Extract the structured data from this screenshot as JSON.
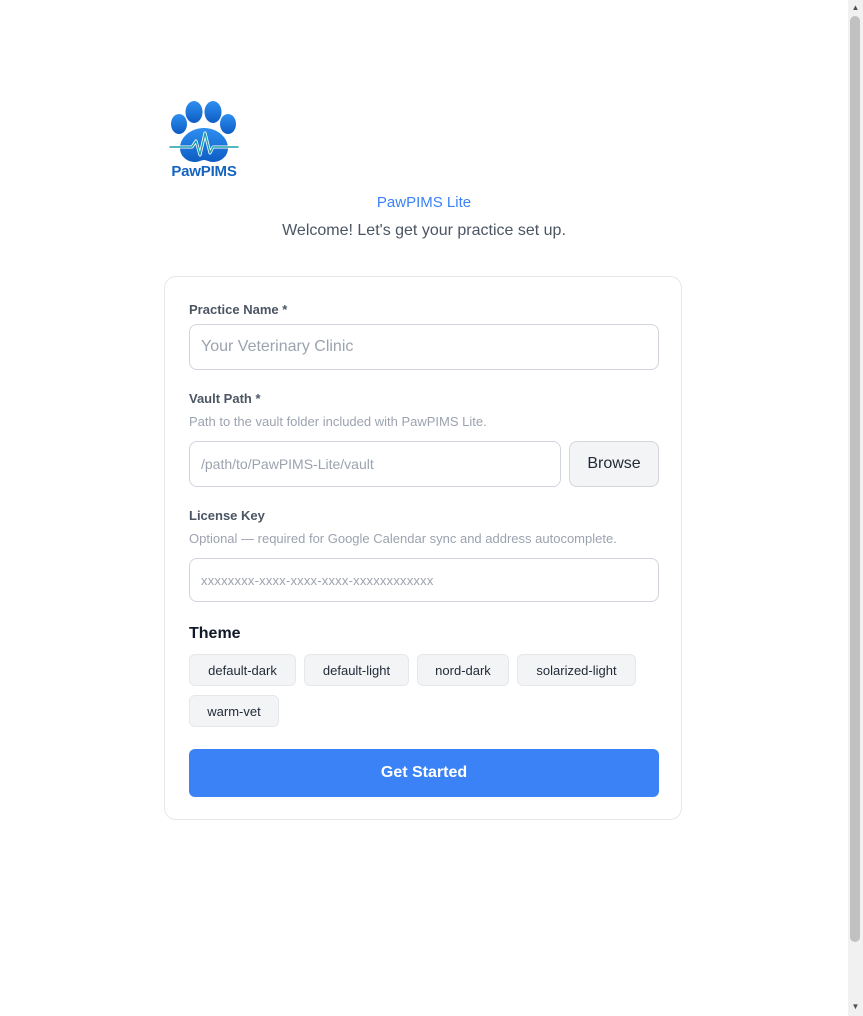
{
  "logo": {
    "text": "PawPIMS",
    "icon": "paw-heartbeat-logo",
    "color": "#1565c0"
  },
  "header": {
    "app_name": "PawPIMS Lite",
    "welcome": "Welcome! Let's get your practice set up."
  },
  "form": {
    "practice_name": {
      "label": "Practice Name *",
      "value": "",
      "placeholder": "Your Veterinary Clinic"
    },
    "vault_path": {
      "label": "Vault Path *",
      "hint": "Path to the vault folder included with PawPIMS Lite.",
      "value": "",
      "placeholder": "/path/to/PawPIMS-Lite/vault",
      "browse_label": "Browse"
    },
    "license_key": {
      "label": "License Key",
      "hint": "Optional — required for Google Calendar sync and address autocomplete.",
      "value": "",
      "placeholder": "xxxxxxxx-xxxx-xxxx-xxxx-xxxxxxxxxxxx"
    },
    "theme": {
      "title": "Theme",
      "options": [
        "default-dark",
        "default-light",
        "nord-dark",
        "solarized-light",
        "warm-vet"
      ]
    },
    "submit_label": "Get Started"
  },
  "colors": {
    "accent": "#3b82f6",
    "border": "#e5e7eb",
    "muted_text": "#9ca3af"
  }
}
